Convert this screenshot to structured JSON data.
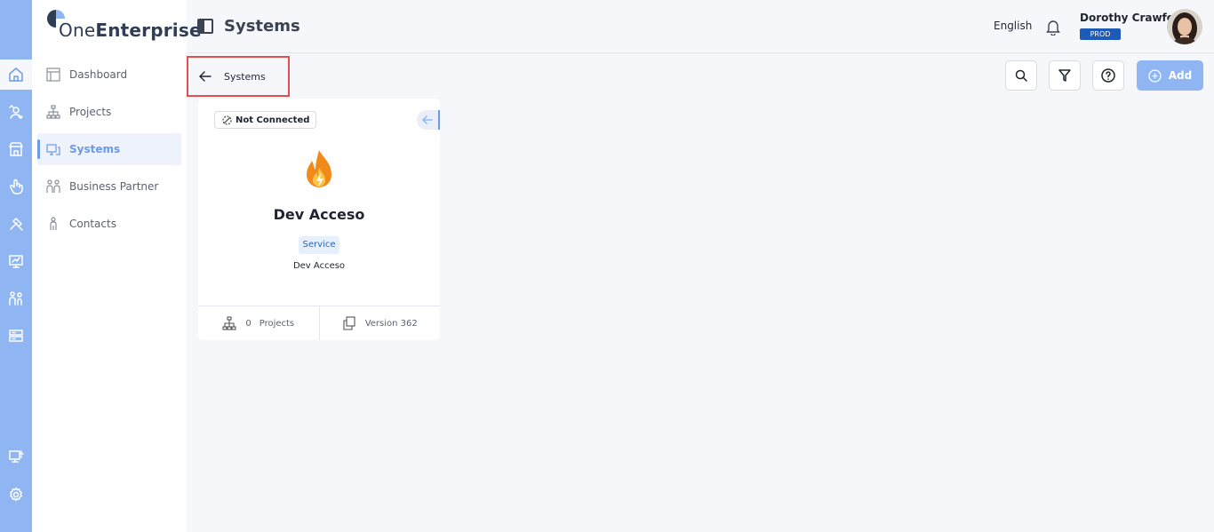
{
  "app": {
    "logo_prefix": "One",
    "logo_suffix": "Enterprise"
  },
  "rail": {
    "items": [
      {
        "icon": "home-icon",
        "active": true
      },
      {
        "icon": "user-switch-icon"
      },
      {
        "icon": "store-icon"
      },
      {
        "icon": "hand-pointer-icon"
      },
      {
        "icon": "tools-icon"
      },
      {
        "icon": "monitor-chart-icon"
      },
      {
        "icon": "people-icon"
      },
      {
        "icon": "server-icon"
      },
      {
        "icon": "display-settings-icon"
      },
      {
        "icon": "gear-icon"
      }
    ]
  },
  "sidebar": {
    "items": [
      {
        "label": "Dashboard",
        "icon": "dashboard-icon"
      },
      {
        "label": "Projects",
        "icon": "hierarchy-icon"
      },
      {
        "label": "Systems",
        "icon": "systems-icon",
        "active": true
      },
      {
        "label": "Business Partner",
        "icon": "partners-icon"
      },
      {
        "label": "Contacts",
        "icon": "contact-icon"
      }
    ]
  },
  "header": {
    "title": "Systems",
    "language": "English",
    "user_name": "Dorothy Crawford",
    "environment": "PROD"
  },
  "breadcrumb": {
    "label": "Systems"
  },
  "toolbar": {
    "add_label": "Add"
  },
  "card": {
    "status": "Not Connected",
    "name": "Dev Acceso",
    "type": "Service",
    "description": "Dev Acceso",
    "projects_count": "0",
    "projects_label": "Projects",
    "version_label": "Version 362"
  },
  "colors": {
    "accent": "#8fb5f2",
    "active": "#6d9ae8",
    "badge": "#1e5bb8",
    "highlight_border": "#e05050"
  }
}
